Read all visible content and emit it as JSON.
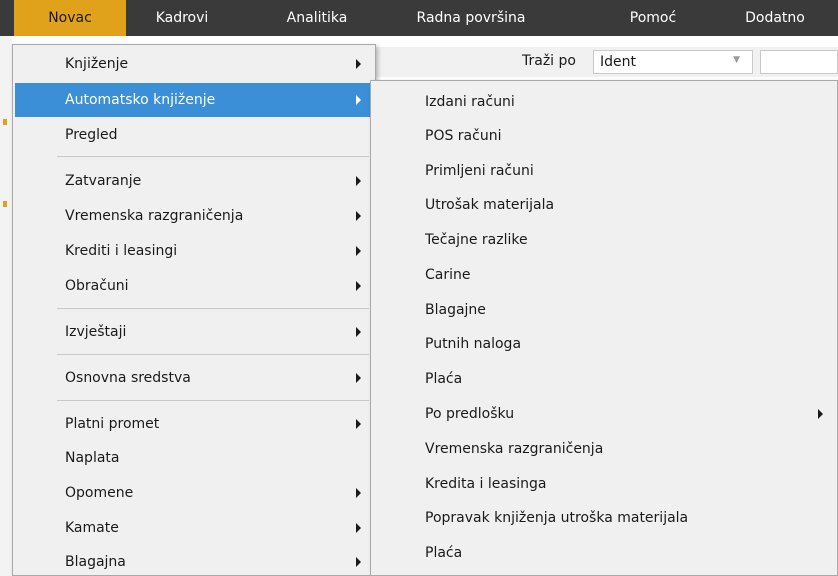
{
  "menubar": {
    "items": [
      {
        "label": "Novac"
      },
      {
        "label": "Kadrovi"
      },
      {
        "label": "Analitika"
      },
      {
        "label": "Radna površina"
      },
      {
        "label": "Pomoć"
      },
      {
        "label": "Dodatno"
      }
    ]
  },
  "toolbar": {
    "search_label": "Traži po",
    "search_select_value": "Ident",
    "search_input_value": ""
  },
  "colors": {
    "accent": "#e0a21a",
    "highlight": "#3a8fd7",
    "menubar_bg": "#3a3a3a"
  },
  "dropdown": {
    "items": [
      {
        "label": "Knjiženje",
        "submenu": true
      },
      {
        "label": "Automatsko knjiženje",
        "submenu": true,
        "highlighted": true
      },
      {
        "label": "Pregled",
        "submenu": false
      },
      {
        "label": "Zatvaranje",
        "submenu": true
      },
      {
        "label": "Vremenska razgraničenja",
        "submenu": true
      },
      {
        "label": "Krediti i leasingi",
        "submenu": true
      },
      {
        "label": "Obračuni",
        "submenu": true
      },
      {
        "label": "Izvještaji",
        "submenu": true
      },
      {
        "label": "Osnovna sredstva",
        "submenu": true
      },
      {
        "label": "Platni promet",
        "submenu": true
      },
      {
        "label": "Naplata",
        "submenu": false
      },
      {
        "label": "Opomene",
        "submenu": true
      },
      {
        "label": "Kamate",
        "submenu": true
      },
      {
        "label": "Blagajna",
        "submenu": true
      }
    ]
  },
  "submenu": {
    "items": [
      {
        "label": "Izdani računi"
      },
      {
        "label": "POS računi"
      },
      {
        "label": "Primljeni računi"
      },
      {
        "label": "Utrošak materijala"
      },
      {
        "label": "Tečajne razlike"
      },
      {
        "label": "Carine"
      },
      {
        "label": "Blagajne"
      },
      {
        "label": "Putnih naloga"
      },
      {
        "label": "Plaća"
      },
      {
        "label": "Po predlošku",
        "submenu": true
      },
      {
        "label": "Vremenska razgraničenja"
      },
      {
        "label": "Kredita i leasinga"
      },
      {
        "label": "Popravak knjiženja utroška materijala"
      },
      {
        "label": "Plaća"
      }
    ]
  }
}
